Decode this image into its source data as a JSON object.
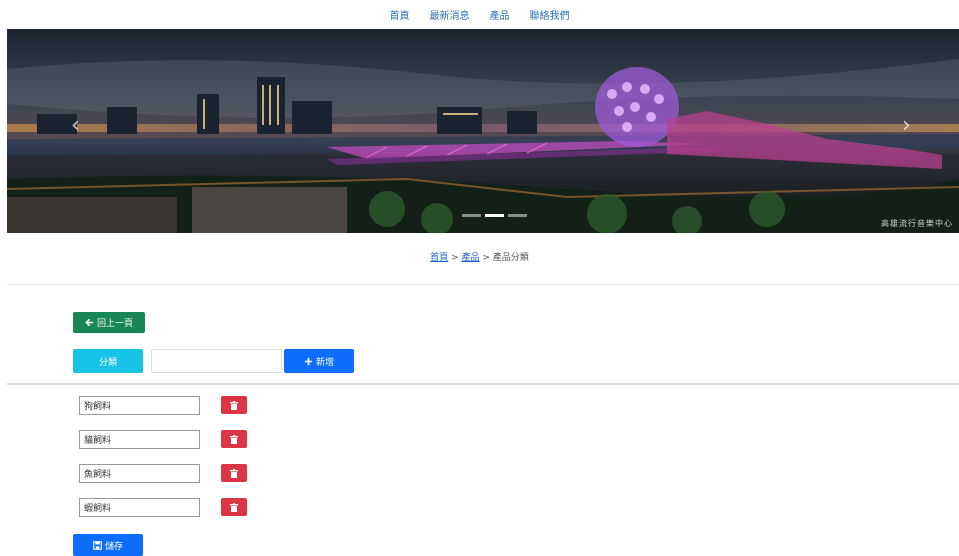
{
  "nav": {
    "items": [
      "首頁",
      "最新消息",
      "產品",
      "聯絡我們"
    ]
  },
  "hero": {
    "caption": "高雄流行音樂中心",
    "prev_icon": "chevron-left-icon",
    "next_icon": "chevron-right-icon",
    "active_slide": 1,
    "slide_count": 3
  },
  "breadcrumb": {
    "home": "首頁",
    "sep1": ">",
    "product": "產品",
    "sep2": ">",
    "current": "產品分類"
  },
  "back_button": {
    "icon": "arrow-left-icon",
    "label": "回上一頁"
  },
  "category": {
    "label": "分類",
    "input_value": "",
    "add_label": "新增",
    "add_icon": "plus-icon"
  },
  "items": [
    {
      "value": "狗飼料"
    },
    {
      "value": "貓飼料"
    },
    {
      "value": "魚飼料"
    },
    {
      "value": "蝦飼料"
    }
  ],
  "delete_icon": "trash-icon",
  "save_button": {
    "icon": "floppy-disk-icon",
    "label": "儲存"
  },
  "colors": {
    "link": "#2a6fb8",
    "success": "#198754",
    "info": "#17c3e6",
    "primary": "#0d6efd",
    "danger": "#dc3545"
  }
}
